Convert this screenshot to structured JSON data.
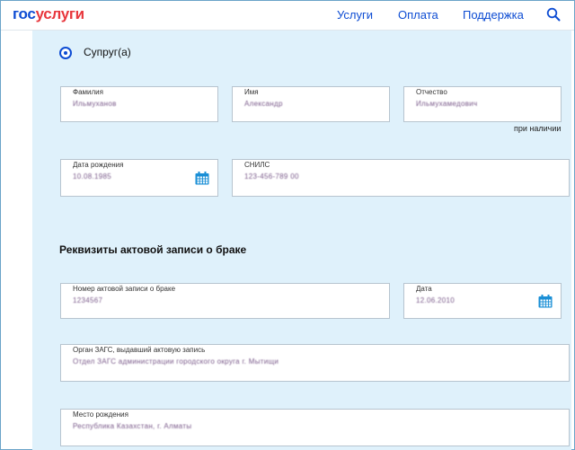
{
  "header": {
    "logo_part1": "гос",
    "logo_part2": "услуги",
    "nav": [
      "Услуги",
      "Оплата",
      "Поддержка"
    ],
    "search_icon": "search-icon"
  },
  "spouse": {
    "option_label": "Супруг(а)",
    "selected": true
  },
  "fields": {
    "surname": {
      "label": "Фамилия",
      "value": "Ильмуханов"
    },
    "name": {
      "label": "Имя",
      "value": "Александр"
    },
    "patronymic": {
      "label": "Отчество",
      "value": "Ильмухамедович"
    },
    "patronymic_hint": "при наличии",
    "birth_date": {
      "label": "Дата рождения",
      "value": "10.08.1985"
    },
    "snils": {
      "label": "СНИЛС",
      "value": "123-456-789 00"
    }
  },
  "marriage": {
    "section_title": "Реквизиты актовой записи о браке",
    "record_number": {
      "label": "Номер актовой записи о браке",
      "value": "1234567"
    },
    "date": {
      "label": "Дата",
      "value": "12.06.2010"
    },
    "registry_office": {
      "label": "Орган ЗАГС, выдавший актовую запись",
      "value": "Отдел ЗАГС администрации городского округа г. Мытищи"
    },
    "birth_place": {
      "label": "Место рождения",
      "value": "Республика Казахстан, г. Алматы"
    }
  },
  "colors": {
    "accent": "#0d4cd3",
    "logo_red": "#e8363c",
    "content_bg": "#dff1fb",
    "field_border": "#b7c4cf"
  }
}
